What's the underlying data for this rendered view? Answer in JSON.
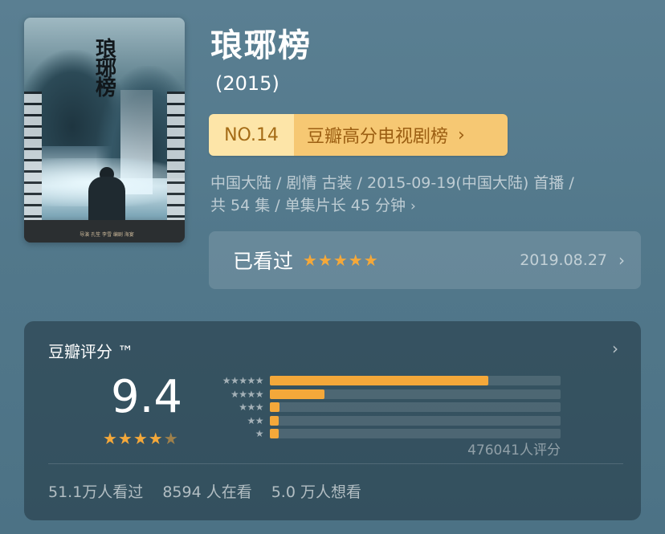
{
  "poster": {
    "title_chars": [
      "琅",
      "琊",
      "榜"
    ],
    "credit": "导演 孔笙 李雪  编剧 海宴"
  },
  "header": {
    "title": "琅琊榜",
    "year": "(2015)"
  },
  "ranking": {
    "number": "NO.14",
    "list_name": "豆瓣高分电视剧榜",
    "chevron": "›"
  },
  "meta": {
    "line1": "中国大陆 / 剧情 古装 / 2015-09-19(中国大陆) 首播 /",
    "line2": "共 54 集 / 单集片长 45 分钟",
    "chevron": "›"
  },
  "watched": {
    "label": "已看过",
    "stars": "★★★★★",
    "user_rating": 5,
    "date": "2019.08.27",
    "chevron": "›"
  },
  "rating": {
    "title": "豆瓣评分 ™",
    "chevron": "›",
    "score": "9.4",
    "stars_full": "★★★★",
    "stars_half": "★",
    "score_stars": 4.5,
    "distribution": [
      {
        "stars": "★★★★★",
        "percent": 75.0
      },
      {
        "stars": "★★★★",
        "percent": 18.8
      },
      {
        "stars": "★★★",
        "percent": 3.4
      },
      {
        "stars": "★★",
        "percent": 1.3
      },
      {
        "stars": "★",
        "percent": 1.5
      }
    ],
    "votes": "476041人评分",
    "stats": {
      "watched": "51.1万人看过",
      "watching": "8594 人在看",
      "wish": "5.0 万人想看"
    }
  },
  "colors": {
    "accent_star": "#f4a83a",
    "rank_num_bg": "#fde5a8",
    "rank_name_bg": "#f6c873",
    "background": "#52788b"
  }
}
